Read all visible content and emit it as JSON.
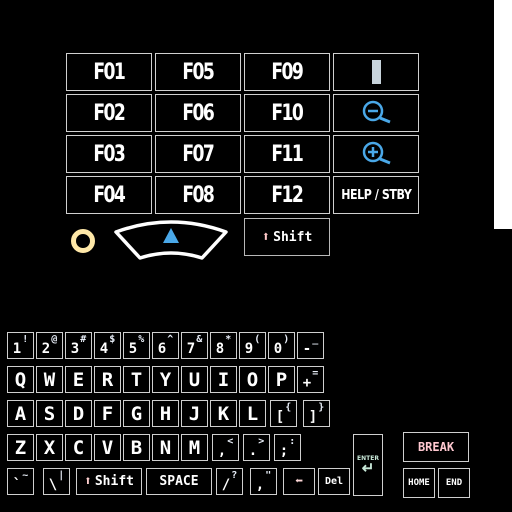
{
  "function_keys": [
    "F01",
    "F05",
    "F09",
    "F02",
    "F06",
    "F10",
    "F03",
    "F07",
    "F11",
    "F04",
    "F08",
    "F12"
  ],
  "help_label": "HELP / STBY",
  "shift_label": "Shift",
  "number_row": [
    {
      "main": "1",
      "shift": "!"
    },
    {
      "main": "2",
      "shift": "@"
    },
    {
      "main": "3",
      "shift": "#"
    },
    {
      "main": "4",
      "shift": "$"
    },
    {
      "main": "5",
      "shift": "%"
    },
    {
      "main": "6",
      "shift": "^"
    },
    {
      "main": "7",
      "shift": "&"
    },
    {
      "main": "8",
      "shift": "*"
    },
    {
      "main": "9",
      "shift": "("
    },
    {
      "main": "0",
      "shift": ")"
    },
    {
      "main": "-",
      "shift": "_"
    }
  ],
  "row_q": [
    "Q",
    "W",
    "E",
    "R",
    "T",
    "Y",
    "U",
    "I",
    "O",
    "P"
  ],
  "plus_key": {
    "main": "+",
    "shift": "="
  },
  "row_a": [
    "A",
    "S",
    "D",
    "F",
    "G",
    "H",
    "J",
    "K",
    "L"
  ],
  "brace_open": {
    "main": "[",
    "shift": "{"
  },
  "brace_close": {
    "main": "]",
    "shift": "}"
  },
  "row_z": [
    "Z",
    "X",
    "C",
    "V",
    "B",
    "N",
    "M"
  ],
  "comma_key": {
    "main": ",",
    "shift": "<"
  },
  "period_key": {
    "main": ".",
    "shift": ">"
  },
  "semicolon_key": {
    "main": ";",
    "shift": ":"
  },
  "enter_label": "ENTER",
  "break_label": "BREAK",
  "backtick_key": {
    "main": "`",
    "shift": "~"
  },
  "backslash_key": {
    "main": "\\",
    "shift": "|"
  },
  "space_label": "SPACE",
  "slash_key": {
    "main": "/",
    "shift": "?"
  },
  "quote_key": {
    "main": ",",
    "shift": "\""
  },
  "del_label": "Del",
  "home_label": "HOME",
  "end_label": "END",
  "colors": {
    "accent_blue": "#4aa8e8",
    "ring": "#ffe8a8"
  }
}
